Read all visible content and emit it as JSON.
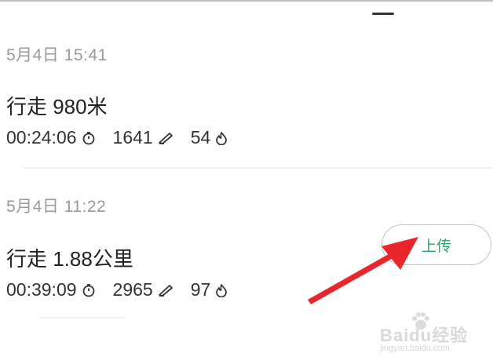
{
  "records": [
    {
      "date": "5月4日 15:41",
      "title": "行走 980米",
      "duration": "00:24:06",
      "steps": "1641",
      "calories": "54",
      "duration_icon": "timer-icon",
      "steps_icon": "shoe-icon",
      "calories_icon": "flame-icon"
    },
    {
      "date": "5月4日 11:22",
      "title": "行走 1.88公里",
      "duration": "00:39:09",
      "steps": "2965",
      "calories": "97",
      "duration_icon": "timer-icon",
      "steps_icon": "shoe-icon",
      "calories_icon": "flame-icon"
    }
  ],
  "upload_button": {
    "label": "上传"
  },
  "annotation": {
    "arrow_color": "#e8262b"
  },
  "watermark": {
    "text": "Baidu经验",
    "sub": "jingyan.baidu.com"
  },
  "colors": {
    "accent": "#2ea36b",
    "date_text": "#9a9a9a"
  }
}
